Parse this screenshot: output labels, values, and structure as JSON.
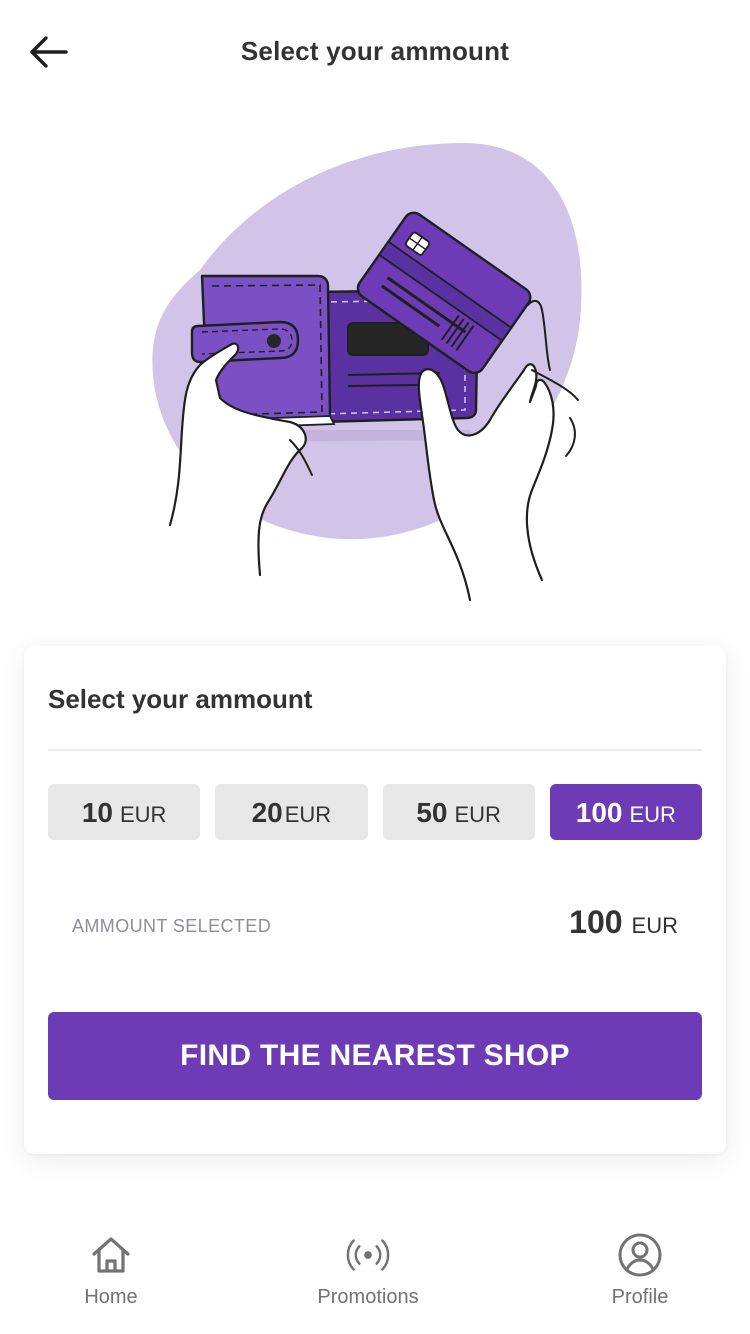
{
  "header": {
    "title": "Select your ammount",
    "back_icon": "arrow-left-icon"
  },
  "colors": {
    "accent": "#6c3bb5",
    "blob": "#d2c4e8",
    "chip_bg": "#e7e7e7",
    "text": "#333333",
    "muted": "#8e8e96"
  },
  "card": {
    "title": "Select your ammount",
    "amounts": [
      {
        "value": "10",
        "currency": "EUR",
        "selected": false
      },
      {
        "value": "20",
        "currency": "EUR",
        "selected": false
      },
      {
        "value": "50",
        "currency": "EUR",
        "selected": false
      },
      {
        "value": "100",
        "currency": "EUR",
        "selected": true
      }
    ],
    "selected_label": "AMMOUNT SELECTED",
    "selected_value": "100",
    "selected_currency": "EUR",
    "cta_label": "FIND THE NEAREST SHOP"
  },
  "tabbar": {
    "items": [
      {
        "label": "Home",
        "icon": "home-icon"
      },
      {
        "label": "Promotions",
        "icon": "broadcast-icon"
      },
      {
        "label": "Profile",
        "icon": "user-circle-icon"
      }
    ]
  }
}
